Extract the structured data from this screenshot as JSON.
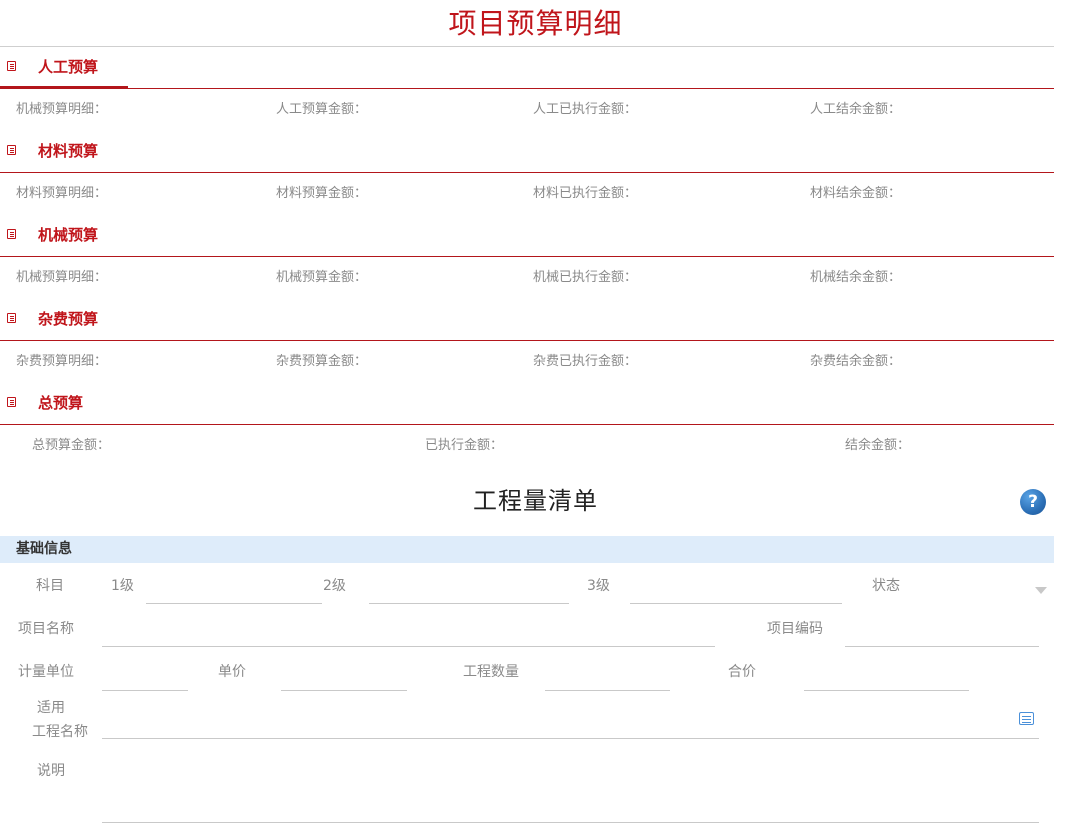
{
  "title": "项目预算明细",
  "sections": [
    {
      "label": "人工预算",
      "fields": [
        "机械预算明细：",
        "人工预算金额：",
        "人工已执行金额：",
        "人工结余金额："
      ]
    },
    {
      "label": "材料预算",
      "fields": [
        "材料预算明细：",
        "材料预算金额：",
        "材料已执行金额：",
        "材料结余金额："
      ]
    },
    {
      "label": "机械预算",
      "fields": [
        "机械预算明细：",
        "机械预算金额：",
        "机械已执行金额：",
        "机械结余金额："
      ]
    },
    {
      "label": "杂费预算",
      "fields": [
        "杂费预算明细：",
        "杂费预算金额：",
        "杂费已执行金额：",
        "杂费结余金额："
      ]
    },
    {
      "label": "总预算",
      "fields": [
        "总预算金额：",
        "已执行金额：",
        "结余金额："
      ]
    }
  ],
  "bill": {
    "title": "工程量清单",
    "help_icon": "?",
    "basic_info": "基础信息",
    "subject": "科目",
    "level1": "1级",
    "level2": "2级",
    "level3": "3级",
    "status": "状态",
    "project_name": "项目名称",
    "project_code": "项目编码",
    "unit": "计量单位",
    "unit_price": "单价",
    "quantity": "工程数量",
    "total_price": "合价",
    "applicable_line1": "适用",
    "applicable_line2": "工程名称",
    "remark": "说明"
  },
  "colors": {
    "accent": "#c0151b",
    "section_bar": "#deecfa",
    "help_icon": "#2b6fb6"
  },
  "icons": {
    "section": "list-icon",
    "help": "help-icon",
    "dropdown": "chevron-down-icon",
    "picker": "picker-icon"
  }
}
